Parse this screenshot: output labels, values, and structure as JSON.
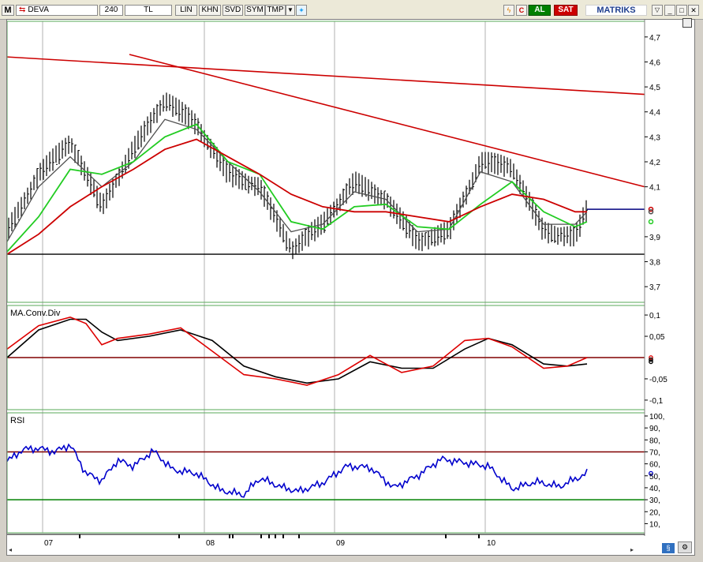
{
  "toolbar": {
    "app_letter": "M",
    "symbol": "DEVA",
    "period": "240",
    "currency": "TL",
    "buttons": [
      "LIN",
      "KHN",
      "SVD",
      "SYM",
      "TMP"
    ],
    "buy_label": "AL",
    "sell_label": "SAT",
    "brand": "MATRIKS"
  },
  "colors": {
    "price_bars": "#000000",
    "ma_fast": "#505050",
    "ma_mid": "#22cc22",
    "ma_slow": "#cc0000",
    "trendline": "#cc0000",
    "support": "#000000",
    "last_price_line": "#000080",
    "macd_line": "#000000",
    "signal_line": "#dd0000",
    "rsi_line": "#0000cc",
    "rsi_upper": "#800000",
    "rsi_lower": "#008000",
    "buy_bg": "#008000",
    "sell_bg": "#cc0000"
  },
  "panels": {
    "price": {
      "y_ticks": [
        "4,7",
        "4,6",
        "4,5",
        "4,4",
        "4,3",
        "4,2",
        "4,1",
        "3,9",
        "3,8",
        "3,7"
      ]
    },
    "macd": {
      "title": "MA.Conv.Div",
      "y_ticks": [
        "0,1",
        "0,05",
        "-0,05",
        "-0,1"
      ]
    },
    "rsi": {
      "title": "RSI",
      "y_ticks": [
        "100,",
        "90,",
        "80,",
        "70,",
        "60,",
        "50,",
        "40,",
        "30,",
        "20,",
        "10,"
      ]
    }
  },
  "x_axis": {
    "months": [
      "07",
      "08",
      "09",
      "10"
    ]
  },
  "chart_data": [
    {
      "type": "line",
      "panel": "price",
      "ylim": [
        3.65,
        4.75
      ],
      "x": [
        0,
        40,
        80,
        120,
        160,
        200,
        240,
        280,
        320,
        360,
        400,
        440,
        480,
        520,
        560,
        600,
        640,
        680,
        720,
        735
      ],
      "series": [
        {
          "values": [
            3.92,
            4.15,
            4.28,
            4.02,
            4.25,
            4.45,
            4.35,
            4.15,
            4.1,
            3.85,
            3.95,
            4.12,
            4.05,
            3.88,
            3.92,
            4.2,
            4.18,
            3.92,
            3.9,
            4.01
          ]
        },
        {
          "values": [
            3.88,
            4.1,
            4.22,
            4.1,
            4.2,
            4.37,
            4.33,
            4.2,
            4.08,
            3.92,
            3.95,
            4.08,
            4.05,
            3.92,
            3.93,
            4.16,
            4.12,
            3.95,
            3.95,
            4.0
          ]
        },
        {
          "values": [
            3.84,
            3.98,
            4.17,
            4.15,
            4.2,
            4.3,
            4.35,
            4.2,
            4.15,
            3.96,
            3.93,
            4.02,
            4.03,
            3.94,
            3.93,
            4.03,
            4.12,
            4.0,
            3.94,
            3.96
          ]
        },
        {
          "values": [
            3.83,
            3.91,
            4.02,
            4.1,
            4.17,
            4.25,
            4.29,
            4.22,
            4.15,
            4.07,
            4.02,
            4.0,
            4.0,
            3.98,
            3.96,
            4.02,
            4.07,
            4.05,
            4.0,
            4.0
          ]
        }
      ],
      "trendlines": [
        {
          "from": [
            0,
            4.62
          ],
          "to": [
            808,
            4.47
          ]
        },
        {
          "from": [
            155,
            4.63
          ],
          "to": [
            808,
            4.1
          ]
        }
      ],
      "support": 3.83,
      "last_price": 4.01,
      "last_labels": [
        "4,01",
        "4,00",
        "3,96"
      ]
    },
    {
      "type": "line",
      "panel": "macd",
      "ylim": [
        -0.115,
        0.115
      ],
      "x": [
        0,
        40,
        80,
        100,
        120,
        140,
        180,
        220,
        260,
        300,
        340,
        380,
        420,
        460,
        500,
        540,
        580,
        610,
        640,
        680,
        710,
        735
      ],
      "series": [
        {
          "values": [
            0.0,
            0.065,
            0.09,
            0.09,
            0.06,
            0.04,
            0.05,
            0.065,
            0.04,
            -0.02,
            -0.045,
            -0.06,
            -0.05,
            -0.01,
            -0.025,
            -0.025,
            0.02,
            0.045,
            0.03,
            -0.015,
            -0.02,
            -0.015
          ]
        },
        {
          "values": [
            0.02,
            0.075,
            0.095,
            0.08,
            0.03,
            0.045,
            0.055,
            0.07,
            0.015,
            -0.04,
            -0.05,
            -0.065,
            -0.04,
            0.005,
            -0.035,
            -0.02,
            0.04,
            0.045,
            0.025,
            -0.025,
            -0.02,
            0.0
          ]
        }
      ],
      "zero_line": 0,
      "last_labels": [
        "0",
        "-0,005",
        "-0,01"
      ]
    },
    {
      "type": "line",
      "panel": "rsi",
      "ylim": [
        5,
        100
      ],
      "x": [
        0,
        20,
        40,
        60,
        80,
        100,
        120,
        140,
        160,
        185,
        210,
        240,
        270,
        300,
        320,
        350,
        370,
        400,
        430,
        460,
        490,
        520,
        550,
        580,
        610,
        640,
        670,
        700,
        735
      ],
      "series": [
        {
          "values": [
            62,
            72,
            73,
            70,
            76,
            52,
            46,
            63,
            58,
            71,
            55,
            52,
            38,
            34,
            48,
            40,
            37,
            44,
            58,
            57,
            40,
            50,
            64,
            61,
            58,
            39,
            45,
            41,
            52
          ]
        }
      ],
      "levels": [
        70,
        30
      ],
      "last_labels": [
        "52,2"
      ]
    }
  ]
}
